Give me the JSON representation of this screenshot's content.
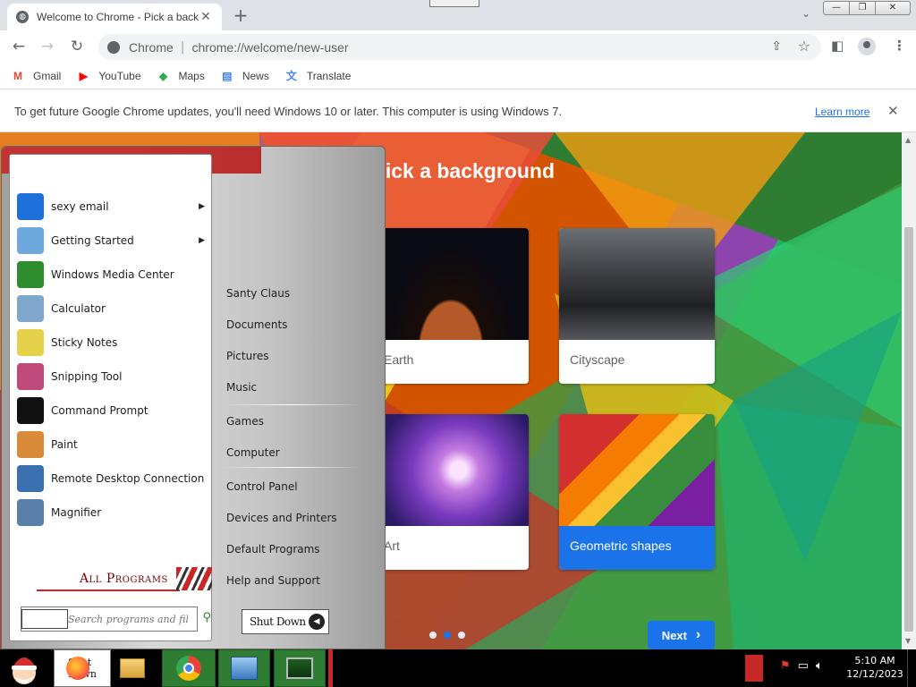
{
  "browser": {
    "tab": {
      "title": "Welcome to Chrome - Pick a background",
      "close": "✕"
    },
    "new_tab": "+",
    "window_controls": {
      "minimize": "—",
      "restore": "❐",
      "close": "✕"
    },
    "omnibox": {
      "site": "Chrome",
      "separator": "|",
      "url": "chrome://welcome/new-user"
    },
    "bookmarks": [
      {
        "label": "Gmail",
        "icon": "gmail-icon",
        "glyph": "M",
        "color": "#ea4335"
      },
      {
        "label": "YouTube",
        "icon": "youtube-icon",
        "glyph": "▶",
        "color": "#ff0000"
      },
      {
        "label": "Maps",
        "icon": "maps-icon",
        "glyph": "◆",
        "color": "#34a853"
      },
      {
        "label": "News",
        "icon": "news-icon",
        "glyph": "▤",
        "color": "#4285f4"
      },
      {
        "label": "Translate",
        "icon": "translate-icon",
        "glyph": "文",
        "color": "#4285f4"
      }
    ],
    "infobar": {
      "message": "To get future Google Chrome updates, you'll need Windows 10 or later. This computer is using Windows 7.",
      "link": "Learn more",
      "close": "✕"
    }
  },
  "page": {
    "title": "Pick a background",
    "cards": [
      {
        "label": "Earth",
        "selected": false
      },
      {
        "label": "Cityscape",
        "selected": false
      },
      {
        "label": "Art",
        "selected": false
      },
      {
        "label": "Geometric shapes",
        "selected": true
      }
    ],
    "pagination": {
      "total": 3,
      "active": 1
    },
    "next_label": "Next",
    "next_arrow": "›"
  },
  "start_menu": {
    "programs": [
      {
        "label": "sexy email",
        "icon": "thunderbird-icon",
        "color": "#1e6fd9",
        "submenu": true
      },
      {
        "label": "Getting Started",
        "icon": "getting-started-icon",
        "color": "#6fa8dc",
        "submenu": true
      },
      {
        "label": "Windows Media Center",
        "icon": "media-center-icon",
        "color": "#2e8b2e",
        "submenu": false
      },
      {
        "label": "Calculator",
        "icon": "calculator-icon",
        "color": "#7fa7cc",
        "submenu": false
      },
      {
        "label": "Sticky Notes",
        "icon": "sticky-notes-icon",
        "color": "#e6d24a",
        "submenu": false
      },
      {
        "label": "Snipping Tool",
        "icon": "snipping-tool-icon",
        "color": "#c04a7a",
        "submenu": false
      },
      {
        "label": "Command Prompt",
        "icon": "command-prompt-icon",
        "color": "#111111",
        "submenu": false
      },
      {
        "label": "Paint",
        "icon": "paint-icon",
        "color": "#d98b3a",
        "submenu": false
      },
      {
        "label": "Remote Desktop Connection",
        "icon": "remote-desktop-icon",
        "color": "#3a6fb0",
        "submenu": false
      },
      {
        "label": "Magnifier",
        "icon": "magnifier-icon",
        "color": "#5a7fa8",
        "submenu": false
      }
    ],
    "all_programs": "All Programs",
    "search_placeholder": "Search programs and files",
    "right_items": [
      "Santy Claus",
      "Documents",
      "Pictures",
      "Music",
      "Games",
      "Computer",
      "Control Panel",
      "Devices and Printers",
      "Default Programs",
      "Help and Support"
    ],
    "shutdown": "Shut Down"
  },
  "taskbar": {
    "clock_time": "5:10 AM",
    "clock_date": "12/12/2023"
  }
}
